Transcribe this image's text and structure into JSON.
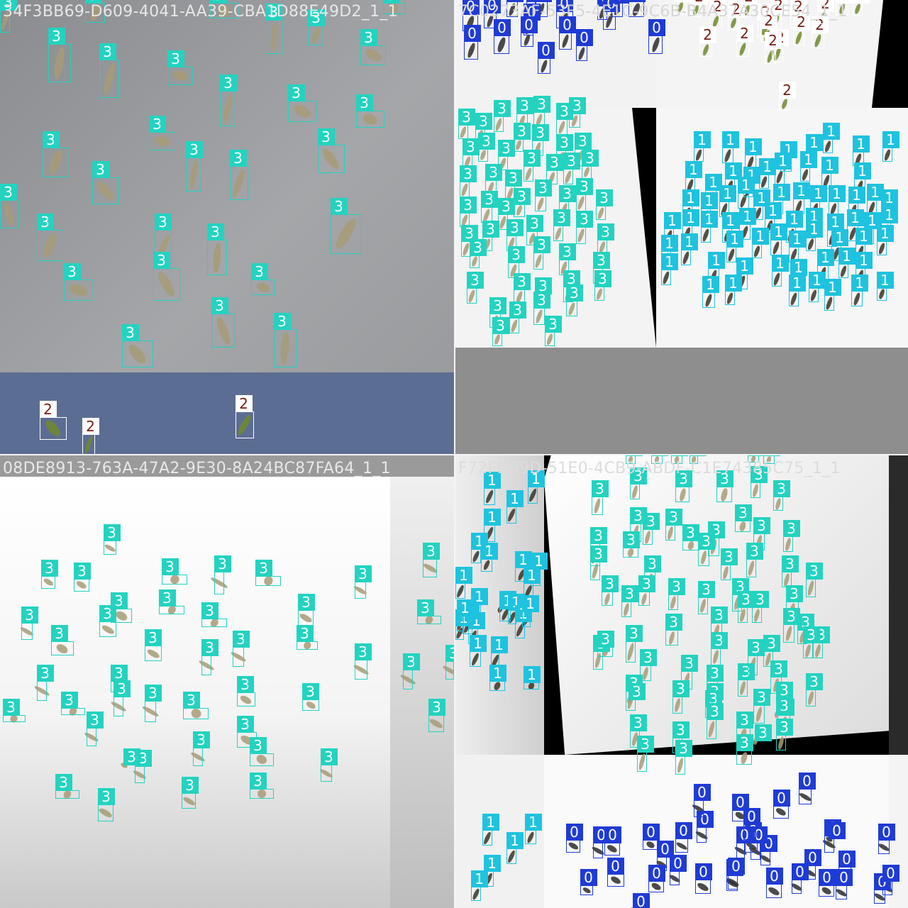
{
  "mosaic": {
    "tiles": [
      {
        "id": "tl",
        "title": "34F3BB69-D609-4041-AA39-CBA1D88E49D2_1_1"
      },
      {
        "id": "tr",
        "title": "7C0273AF-53F5-4E1C-9C6B-B4A37A30CE54_1_1"
      },
      {
        "id": "bl",
        "title": "08DE8913-763A-47A2-9E30-8A24BC87FA64_1_1"
      },
      {
        "id": "br",
        "title": "F72FD99D-51E0-4CB9-ABDF-C1E74385C75_1_1"
      }
    ]
  },
  "classes": {
    "0": {
      "label": "0",
      "box_color": "#1f3bd6",
      "tag_color": "#1f3bd6"
    },
    "1": {
      "label": "1",
      "box_color": "#1ec3df",
      "tag_color": "#1ec3df"
    },
    "2": {
      "label": "2",
      "box_color": "#ffffff",
      "tag_color": "#ffffff"
    },
    "3": {
      "label": "3",
      "box_color": "#23d3c0",
      "tag_color": "#23d3c0"
    }
  }
}
